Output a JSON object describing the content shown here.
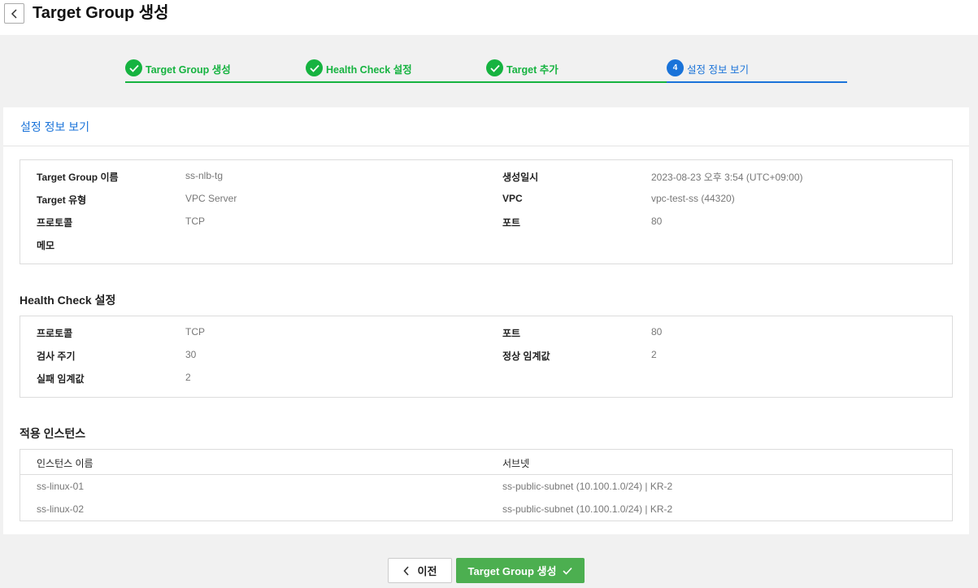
{
  "header": {
    "title": "Target Group 생성"
  },
  "steps": [
    {
      "label": "Target Group 생성",
      "state": "done"
    },
    {
      "label": "Health Check 설정",
      "state": "done"
    },
    {
      "label": "Target 추가",
      "state": "done"
    },
    {
      "label": "설정 정보 보기",
      "state": "active",
      "number": "4"
    }
  ],
  "panel": {
    "title": "설정 정보 보기"
  },
  "target_group": {
    "name_label": "Target Group 이름",
    "name_value": "ss-nlb-tg",
    "type_label": "Target 유형",
    "type_value": "VPC Server",
    "protocol_label": "프로토콜",
    "protocol_value": "TCP",
    "memo_label": "메모",
    "created_label": "생성일시",
    "created_value": "2023-08-23 오후 3:54 (UTC+09:00)",
    "vpc_label": "VPC",
    "vpc_value": "vpc-test-ss (44320)",
    "port_label": "포트",
    "port_value": "80"
  },
  "health_check": {
    "title": "Health Check 설정",
    "protocol_label": "프로토콜",
    "protocol_value": "TCP",
    "interval_label": "검사 주기",
    "interval_value": "30",
    "fail_label": "실패 임계값",
    "fail_value": "2",
    "port_label": "포트",
    "port_value": "80",
    "healthy_label": "정상 임계값",
    "healthy_value": "2"
  },
  "instances": {
    "title": "적용 인스턴스",
    "columns": [
      "인스턴스 이름",
      "서브넷"
    ],
    "rows": [
      [
        "ss-linux-01",
        "ss-public-subnet (10.100.1.0/24) | KR-2"
      ],
      [
        "ss-linux-02",
        "ss-public-subnet (10.100.1.0/24) | KR-2"
      ]
    ]
  },
  "footer": {
    "prev_label": "이전",
    "create_label": "Target Group 생성"
  },
  "colors": {
    "done": "#16b340",
    "active": "#1a73d9",
    "primary_button": "#4caf50"
  }
}
